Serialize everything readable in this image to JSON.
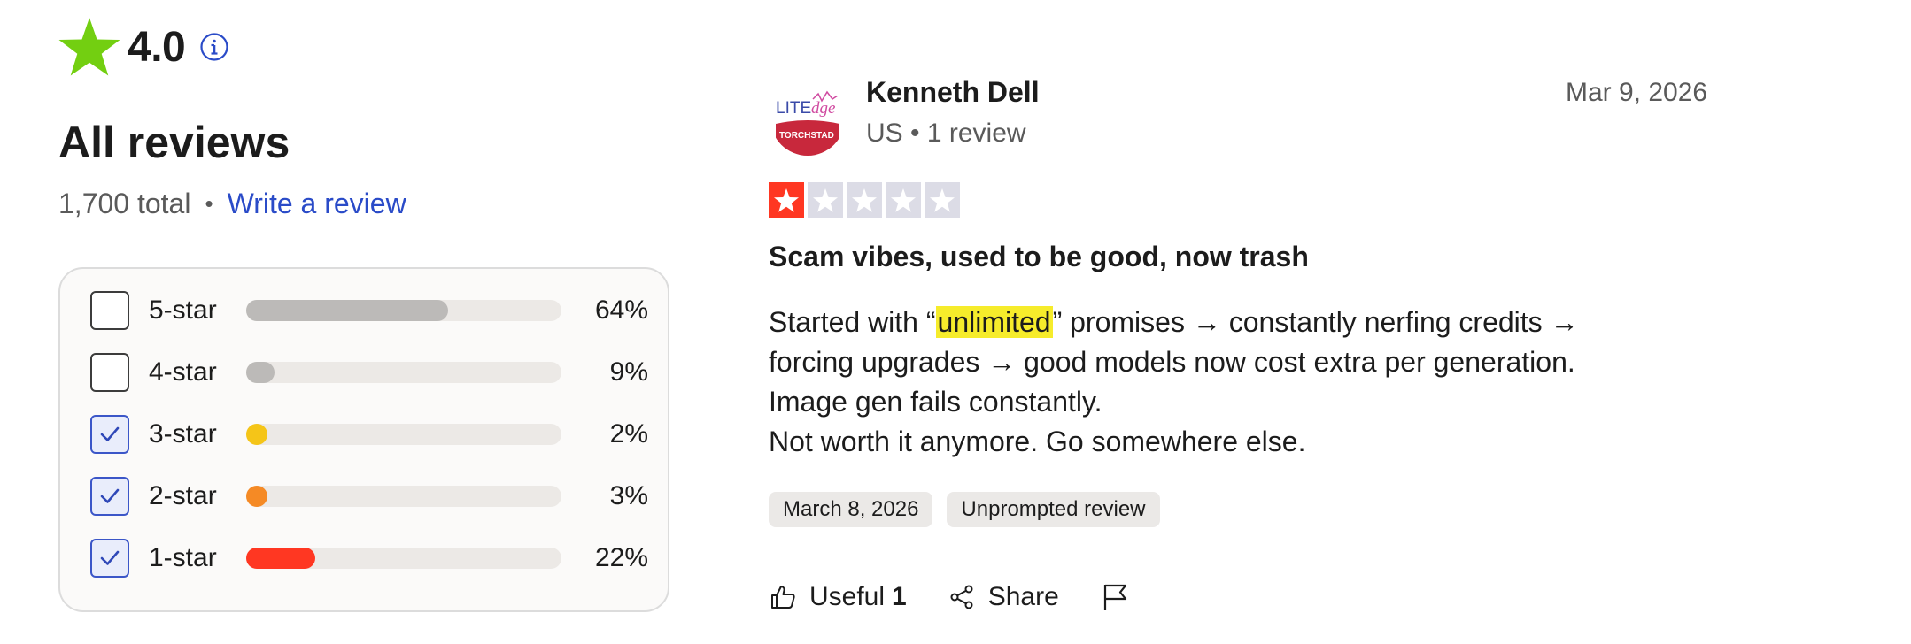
{
  "summary": {
    "score": "4.0",
    "heading": "All reviews",
    "total": "1,700 total",
    "separator": "•",
    "write_review": "Write a review"
  },
  "breakdown": [
    {
      "label": "5-star",
      "percent_text": "64%",
      "fill_fraction": 0.64,
      "checked": false,
      "color": "#bcbab8"
    },
    {
      "label": "4-star",
      "percent_text": "9%",
      "fill_fraction": 0.09,
      "checked": false,
      "color": "#bcbab8"
    },
    {
      "label": "3-star",
      "percent_text": "2%",
      "fill_fraction": 0.02,
      "checked": true,
      "color": "#f5c518"
    },
    {
      "label": "2-star",
      "percent_text": "3%",
      "fill_fraction": 0.03,
      "checked": true,
      "color": "#f58a25"
    },
    {
      "label": "1-star",
      "percent_text": "22%",
      "fill_fraction": 0.22,
      "checked": true,
      "color": "#ff3722"
    }
  ],
  "review": {
    "reviewer_name": "Kenneth Dell",
    "reviewer_meta": "US • 1 review",
    "date": "Mar 9, 2026",
    "rating": 1,
    "title": "Scam vibes, used to be good, now trash",
    "body": {
      "line1_before": "Started with “",
      "line1_highlight": "unlimited",
      "line1_after": "” promises → constantly nerfing credits →",
      "line2": "forcing upgrades → good models now cost extra per generation.",
      "line3": "Image gen fails constantly.",
      "line4": "Not worth it anymore. Go somewhere else."
    },
    "tags": [
      "March 8, 2026",
      "Unprompted review"
    ],
    "actions": {
      "useful_label": "Useful",
      "useful_count": "1",
      "share_label": "Share"
    }
  },
  "colors": {
    "brand_green": "#73cf11",
    "link_blue": "#2a4bc8",
    "one_star_red": "#ff3722",
    "highlight_yellow": "#f6ec2b"
  },
  "icons": [
    "star-icon",
    "info-icon",
    "check-icon",
    "thumbs-up-icon",
    "share-icon",
    "flag-icon"
  ]
}
